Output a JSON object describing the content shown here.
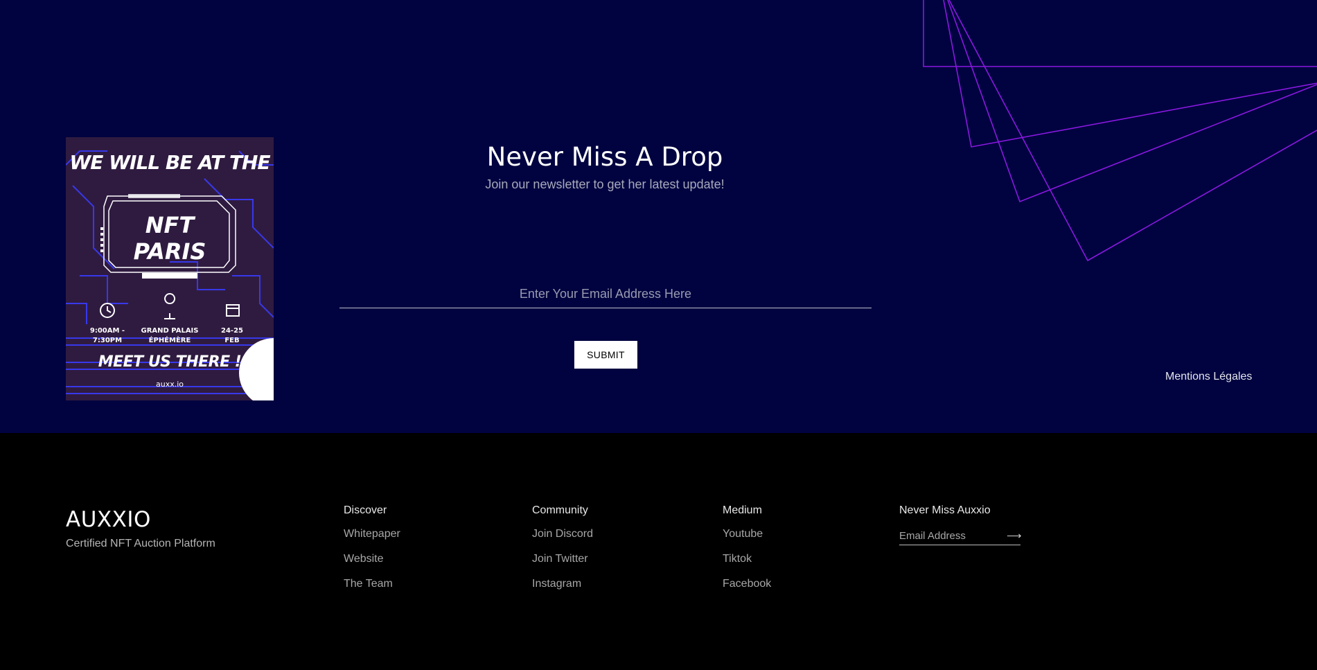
{
  "newsletter": {
    "title": "Never Miss A Drop",
    "subtitle": "Join our newsletter to get her latest update!",
    "email_placeholder": "Enter Your Email Address Here",
    "submit_label": "SUBMIT",
    "legal_link": "Mentions Légales"
  },
  "poster": {
    "headline": "WE WILL BE AT THE",
    "event": "NFT\nPARIS",
    "time": "9:00AM -\n7:30PM",
    "venue": "GRAND PALAIS\nÉPHÉMÈRE",
    "date": "24-25\nFEB",
    "cta": "MEET US THERE !",
    "url": "auxx.io"
  },
  "footer": {
    "brand": "AUXXIO",
    "tagline": "Certified NFT Auction Platform",
    "columns": [
      {
        "title": "Discover",
        "links": [
          "Whitepaper",
          "Website",
          "The Team"
        ]
      },
      {
        "title": "Community",
        "links": [
          "Join Discord",
          "Join Twitter",
          "Instagram"
        ]
      },
      {
        "title": "Medium",
        "links": [
          "Youtube",
          "Tiktok",
          "Facebook"
        ]
      }
    ],
    "subscribe": {
      "title": "Never Miss Auxxio",
      "email_placeholder": "Email Address",
      "submit_icon": "arrow-right-icon"
    }
  },
  "colors": {
    "newsletter_bg": "#000340",
    "footer_bg": "#000000",
    "accent_purple": "#8a18e0",
    "poster_blue": "#3a3cff"
  }
}
